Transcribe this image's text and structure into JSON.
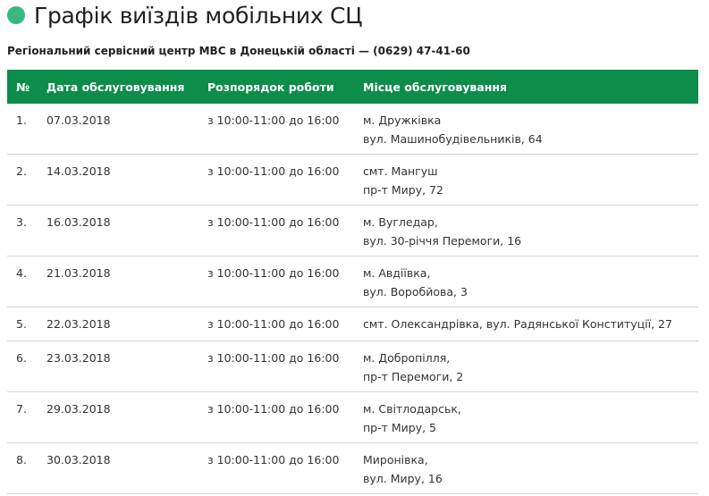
{
  "header": {
    "title": "Графік виїздів мобільних СЦ",
    "dot_color": "#3bb77e"
  },
  "subtitle": "Регіональний сервісний центр МВС в Донецькій області — (0629) 47-41-60",
  "table": {
    "header_color": "#0e8c4a",
    "columns": [
      "№",
      "Дата обслуговування",
      "Розпорядок роботи",
      "Місце обслуговування"
    ],
    "rows": [
      {
        "num": "1.",
        "date": "07.03.2018",
        "hours": "з 10:00-11:00 до 16:00",
        "place": [
          "м. Дружківка",
          "вул. Машинобудівельників, 64"
        ]
      },
      {
        "num": "2.",
        "date": "14.03.2018",
        "hours": "з 10:00-11:00 до 16:00",
        "place": [
          "смт. Мангуш",
          "пр-т Миру, 72"
        ]
      },
      {
        "num": "3.",
        "date": "16.03.2018",
        "hours": "з 10:00-11:00 до 16:00",
        "place": [
          "м. Вугледар,",
          "вул. 30-річчя Перемоги, 16"
        ]
      },
      {
        "num": "4.",
        "date": "21.03.2018",
        "hours": "з 10:00-11:00 до 16:00",
        "place": [
          "м. Авдіївка,",
          "вул. Воробйова, 3"
        ]
      },
      {
        "num": "5.",
        "date": "22.03.2018",
        "hours": "з 10:00-11:00 до 16:00",
        "place": [
          "смт. Олександрівка, вул. Радянської Конституції, 27"
        ]
      },
      {
        "num": "6.",
        "date": "23.03.2018",
        "hours": "з 10:00-11:00 до 16:00",
        "place": [
          "м. Добропілля,",
          "пр-т Перемоги, 2"
        ]
      },
      {
        "num": "7.",
        "date": "29.03.2018",
        "hours": "з 10:00-11:00 до 16:00",
        "place": [
          "м. Світлодарськ,",
          "пр-т Миру, 5"
        ]
      },
      {
        "num": "8.",
        "date": "30.03.2018",
        "hours": "з 10:00-11:00 до 16:00",
        "place": [
          "Миронівка,",
          "вул. Миру, 16"
        ]
      }
    ]
  }
}
